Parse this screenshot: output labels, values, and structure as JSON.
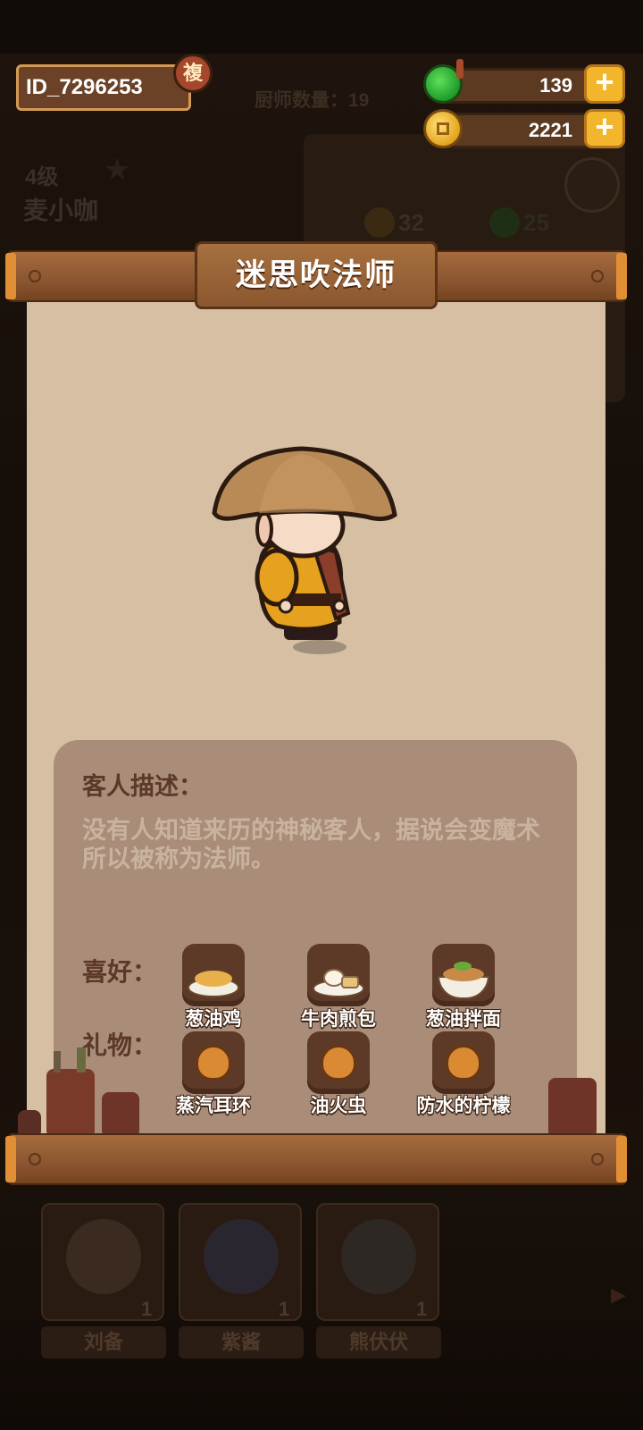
{
  "header": {
    "player_id": "ID_7296253",
    "copy_label": "複",
    "chef_count": "厨师数量：19",
    "level": "4级",
    "player_name": "麦小咖",
    "gems": "139",
    "coins": "2221",
    "bg_stat_1": "32",
    "bg_stat_2": "25"
  },
  "popup": {
    "title": "迷思吹法师",
    "description_heading": "客人描述：",
    "description": "没有人知道来历的神秘客人，据说会变魔术所以被称为法师。",
    "preferences_label": "喜好：",
    "gifts_label": "礼物：",
    "preferences": [
      {
        "name": "葱油鸡",
        "icon": "scallion-chicken-icon"
      },
      {
        "name": "牛肉煎包",
        "icon": "beef-bun-icon"
      },
      {
        "name": "葱油拌面",
        "icon": "scallion-noodles-icon"
      }
    ],
    "gifts": [
      {
        "name": "蒸汽耳环",
        "icon": "steam-earring-icon"
      },
      {
        "name": "油火虫",
        "icon": "oil-firefly-icon"
      },
      {
        "name": "防水的柠檬",
        "icon": "waterproof-lemon-icon"
      }
    ]
  },
  "chefs": [
    {
      "name": "刘备",
      "count": "1"
    },
    {
      "name": "紫酱",
      "count": "1"
    },
    {
      "name": "熊伏伏",
      "count": "1"
    }
  ],
  "colors": {
    "paper": "#d6bfa3",
    "info_box": "#a98d79",
    "wood": "#8a5530",
    "accent_orange": "#f3b52c"
  }
}
